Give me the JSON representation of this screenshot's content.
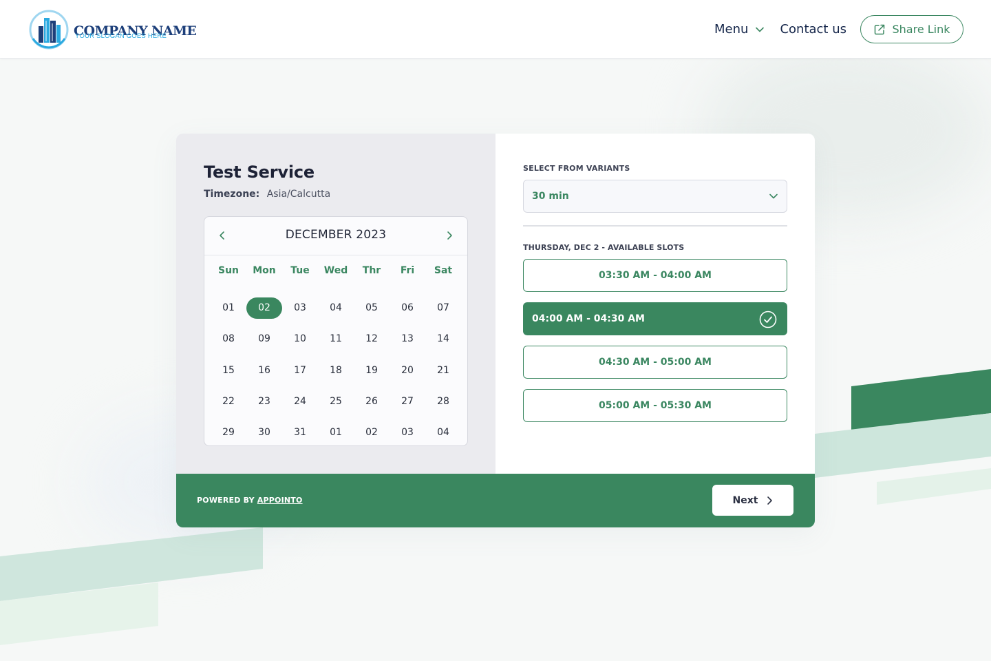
{
  "header": {
    "company_name": "COMPANY NAME",
    "slogan": "YOUR SLOGAN GOES HERE",
    "menu_label": "Menu",
    "contact_label": "Contact us",
    "share_label": "Share Link"
  },
  "service": {
    "title": "Test Service",
    "timezone_label": "Timezone:",
    "timezone_value": "Asia/Calcutta"
  },
  "calendar": {
    "month_label": "DECEMBER 2023",
    "weekdays": [
      "Sun",
      "Mon",
      "Tue",
      "Wed",
      "Thr",
      "Fri",
      "Sat"
    ],
    "days": [
      "01",
      "02",
      "03",
      "04",
      "05",
      "06",
      "07",
      "08",
      "09",
      "10",
      "11",
      "12",
      "13",
      "14",
      "15",
      "16",
      "17",
      "18",
      "19",
      "20",
      "21",
      "22",
      "23",
      "24",
      "25",
      "26",
      "27",
      "28",
      "29",
      "30",
      "31",
      "01",
      "02",
      "03",
      "04"
    ],
    "selected_index": 1
  },
  "variants": {
    "label": "SELECT FROM VARIANTS",
    "selected": "30 min"
  },
  "slots": {
    "label": "THURSDAY, DEC 2 - AVAILABLE SLOTS",
    "items": [
      {
        "label": "03:30 AM - 04:00 AM",
        "selected": false
      },
      {
        "label": "04:00 AM - 04:30 AM",
        "selected": true
      },
      {
        "label": "04:30 AM - 05:00 AM",
        "selected": false
      },
      {
        "label": "05:00 AM - 05:30 AM",
        "selected": false
      }
    ]
  },
  "footer": {
    "powered_prefix": "POWERED BY ",
    "powered_link": "APPOINTO",
    "next_label": "Next"
  },
  "colors": {
    "accent": "#3a875f",
    "header_text": "#15264a",
    "calendar_bg": "#ebebef"
  },
  "icons": {
    "logo": "building-logo-icon",
    "menu_chevron": "chevron-down-icon",
    "share": "external-link-icon",
    "prev": "chevron-left-icon",
    "next_month": "chevron-right-icon",
    "select_chevron": "chevron-down-icon",
    "selected_check": "check-circle-icon",
    "next_arrow": "chevron-right-icon"
  }
}
